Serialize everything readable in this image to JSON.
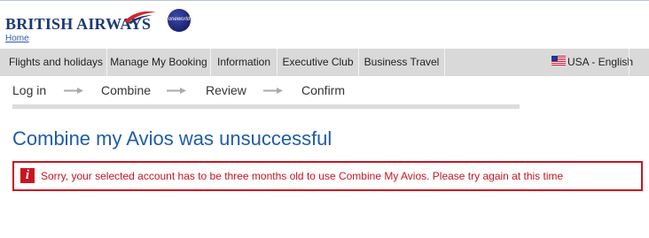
{
  "header": {
    "brand": "BRITISH AIRWAYS",
    "home_link": "Home",
    "alliance_badge": "oneworld",
    "brand_color": "#1b3a73"
  },
  "nav": {
    "items": [
      {
        "label": "Flights and holidays"
      },
      {
        "label": "Manage My Booking"
      },
      {
        "label": "Information"
      },
      {
        "label": "Executive Club"
      },
      {
        "label": "Business Travel"
      }
    ],
    "language": "USA - English",
    "flag_icon": "us-flag-icon",
    "background": "#d9d9d9"
  },
  "steps": {
    "items": [
      {
        "label": "Log in"
      },
      {
        "label": "Combine"
      },
      {
        "label": "Review"
      },
      {
        "label": "Confirm"
      }
    ],
    "arrow_icon": "arrow-right-icon"
  },
  "main": {
    "title": "Combine my Avios was unsuccessful",
    "title_color": "#1f5ca8",
    "error": {
      "icon": "info-icon",
      "icon_glyph": "i",
      "message": "Sorry, your selected account has to be three months old to use Combine My Avios. Please try again at this time",
      "color": "#c91521"
    }
  }
}
